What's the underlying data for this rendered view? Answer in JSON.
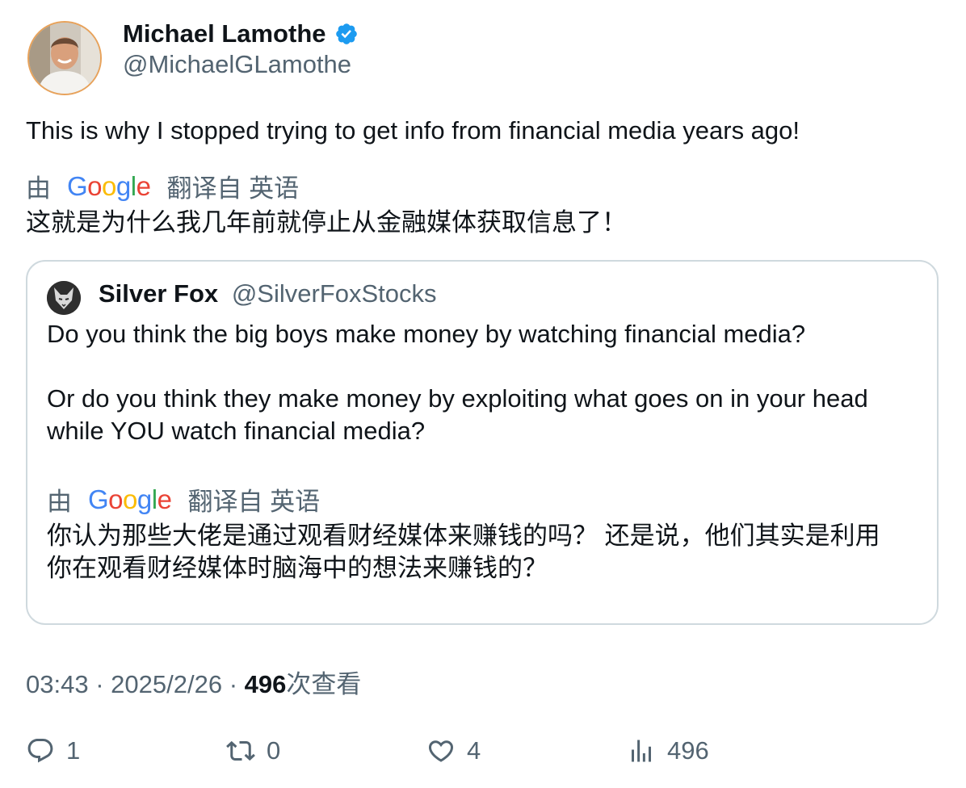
{
  "author": {
    "display_name": "Michael Lamothe",
    "handle": "@MichaelGLamothe",
    "verified": true
  },
  "tweet": {
    "text": "This is why I stopped trying to get info from financial media years ago!",
    "translation": {
      "prefix": "由",
      "provider": "Google",
      "suffix": "翻译自 英语",
      "text": "这就是为什么我几年前就停止从金融媒体获取信息了！"
    }
  },
  "quoted_tweet": {
    "display_name": "Silver Fox",
    "handle": "@SilverFoxStocks",
    "lines": [
      "Do you think the big boys make money by watching financial media?",
      "",
      "Or do you think they make money by exploiting what goes on in your head",
      "while YOU watch financial media?"
    ],
    "translation": {
      "prefix": "由",
      "provider": "Google",
      "suffix": "翻译自 英语",
      "line1": "你认为那些大佬是通过观看财经媒体来赚钱的吗？ 还是说，他们其实是利用",
      "line2": "你在观看财经媒体时脑海中的想法来赚钱的？"
    }
  },
  "meta": {
    "time": "03:43",
    "separator": "·",
    "date": "2025/2/26",
    "views_count": "496",
    "views_label": "次查看"
  },
  "actions": {
    "replies": "1",
    "reposts": "0",
    "likes": "4",
    "views": "496"
  },
  "icons": {
    "verified": "verified-badge-icon",
    "reply": "reply-icon",
    "repost": "repost-icon",
    "like": "heart-icon",
    "views": "analytics-icon"
  },
  "colors": {
    "text_primary": "#0f1419",
    "text_secondary": "#536471",
    "verified_blue": "#1d9bf0",
    "border": "#cfd9de"
  }
}
